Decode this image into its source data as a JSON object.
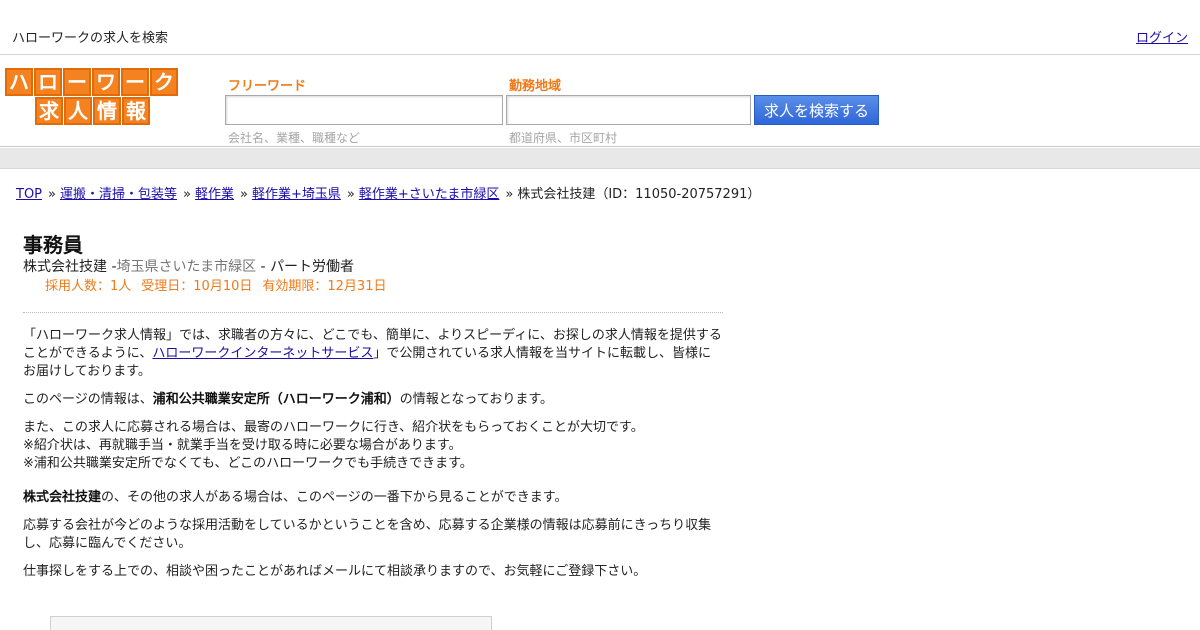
{
  "topbar": {
    "site_title": "ハローワークの求人を検索",
    "login_label": "ログイン"
  },
  "logo": {
    "row1": [
      "ハ",
      "ロ",
      "ー",
      "ワ",
      "ー",
      "ク"
    ],
    "row2": [
      "求",
      "人",
      "情",
      "報"
    ]
  },
  "search": {
    "free_label": "フリーワード",
    "area_label": "勤務地域",
    "free_value": "",
    "area_value": "",
    "free_hint": "会社名、業種、職種など",
    "area_hint": "都道府県、市区町村",
    "button_label": "求人を検索する"
  },
  "breadcrumb": {
    "sep": "»",
    "items": [
      "TOP",
      "運搬・清掃・包装等",
      "軽作業",
      "軽作業+埼玉県",
      "軽作業+さいたま市緑区"
    ],
    "current": "株式会社技建（ID：11050-20757291）"
  },
  "job": {
    "title": "事務員",
    "company": "株式会社技建",
    "dash1": " -",
    "location": "埼玉県さいたま市緑区",
    "dash2": " - ",
    "employment": "パート労働者",
    "headcount": "採用人数：1人",
    "received": "受理日：10月10日",
    "expires": "有効期限：12月31日"
  },
  "intro": {
    "p1_a": "「ハローワーク求人情報」では、求職者の方々に、どこでも、簡単に、よりスピーディに、お探しの求人情報を提供することができるように、",
    "p1_link": "ハローワークインターネットサービス",
    "p1_b": "」で公開されている求人情報を当サイトに転載し、皆様にお届けしております。",
    "p2_a": "このページの情報は、",
    "p2_bold": "浦和公共職業安定所（ハローワーク浦和）",
    "p2_b": "の情報となっております。",
    "p3_l1": "また、この求人に応募される場合は、最寄のハローワークに行き、紹介状をもらっておくことが大切です。",
    "p3_l2": "※紹介状は、再就職手当・就業手当を受け取る時に必要な場合があります。",
    "p3_l3": "※浦和公共職業安定所でなくても、どこのハローワークでも手続きできます。",
    "p4_bold": "株式会社技建",
    "p4_rest": "の、その他の求人がある場合は、このページの一番下から見ることができます。",
    "p5": "応募する会社が今どのような採用活動をしているかということを含め、応募する企業様の情報は応募前にきっちり収集し、応募に臨んでください。",
    "p6": "仕事探しをする上での、相談や困ったことがあればメールにて相談承りますので、お気軽にご登録下さい。"
  }
}
